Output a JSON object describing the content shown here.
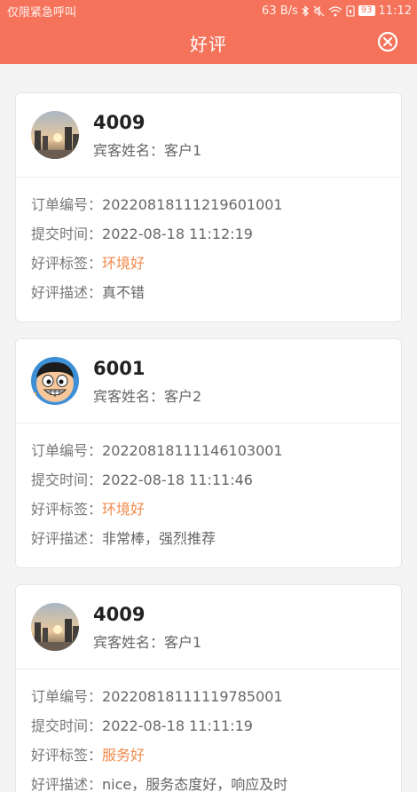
{
  "status_bar": {
    "left_text": "仅限紧急呼叫",
    "network_speed": "63 B/s",
    "battery": "93",
    "time": "11:12"
  },
  "header": {
    "title": "好评",
    "close_icon": "close-circle-icon"
  },
  "labels": {
    "guest_name": "宾客姓名：",
    "order_no": "订单编号：",
    "submit_time": "提交时间：",
    "tag": "好评标签：",
    "desc": "好评描述："
  },
  "reviews": [
    {
      "room": "4009",
      "guest_name": "客户1",
      "order_no": "20220818111219601001",
      "submit_time": "2022-08-18 11:12:19",
      "tag": "环境好",
      "desc": "真不错",
      "avatar": "city-sunset-avatar"
    },
    {
      "room": "6001",
      "guest_name": "客户2",
      "order_no": "20220818111146103001",
      "submit_time": "2022-08-18 11:11:46",
      "tag": "环境好",
      "desc": "非常棒，强烈推荐",
      "avatar": "cartoon-pirate-avatar"
    },
    {
      "room": "4009",
      "guest_name": "客户1",
      "order_no": "20220818111119785001",
      "submit_time": "2022-08-18 11:11:19",
      "tag": "服务好",
      "desc": "nice，服务态度好，响应及时",
      "avatar": "city-sunset-avatar"
    }
  ],
  "colors": {
    "header_bg": "#f5735b",
    "tag_text": "#f08a4b"
  }
}
